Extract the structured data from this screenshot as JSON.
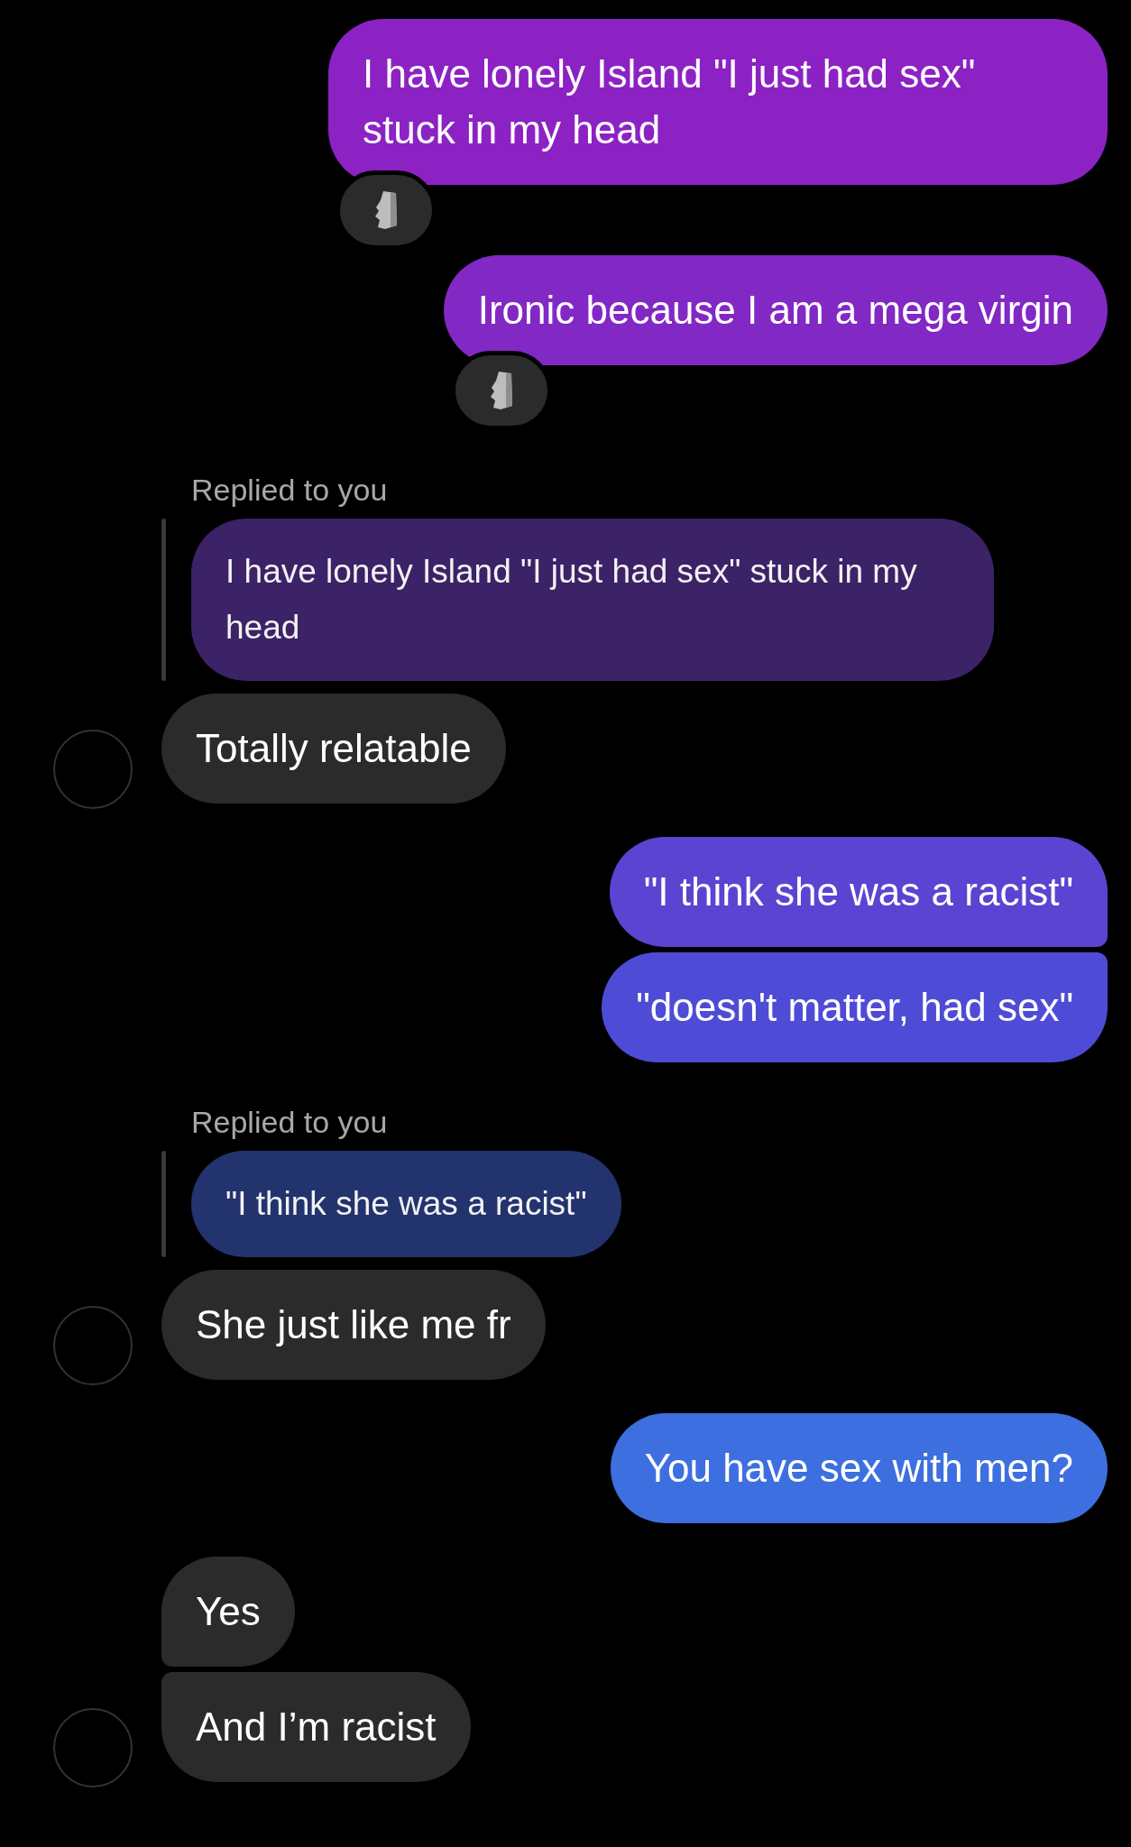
{
  "messages": [
    {
      "kind": "sent",
      "text": "I have lonely Island \"I just had sex\" stuck in my head",
      "color": "#8c22c4",
      "reacted": true
    },
    {
      "kind": "sent",
      "text": "Ironic because I am a mega virgin",
      "color": "#8228c4",
      "reacted": true
    },
    {
      "kind": "reply_label",
      "text": "Replied to you"
    },
    {
      "kind": "quote",
      "text": "I have lonely Island \"I just had sex\" stuck in my head",
      "color": "#3c2266"
    },
    {
      "kind": "received",
      "text": "Totally relatable",
      "avatar": true
    },
    {
      "kind": "sent",
      "text": "\"I think she was a racist\"",
      "color": "#5b44d2",
      "reacted": false
    },
    {
      "kind": "sent",
      "text": "\"doesn't matter, had sex\"",
      "color": "#4e4cd6",
      "reacted": false
    },
    {
      "kind": "reply_label",
      "text": "Replied to you"
    },
    {
      "kind": "quote",
      "text": "\"I think she was a racist\"",
      "color": "#23336e"
    },
    {
      "kind": "received",
      "text": "She just like me fr",
      "avatar": true
    },
    {
      "kind": "sent",
      "text": "You have sex with men?",
      "color": "#3d6fe0",
      "reacted": false
    },
    {
      "kind": "received",
      "text": "Yes",
      "avatar": false
    },
    {
      "kind": "received",
      "text": "And I’m racist",
      "avatar": true
    }
  ]
}
